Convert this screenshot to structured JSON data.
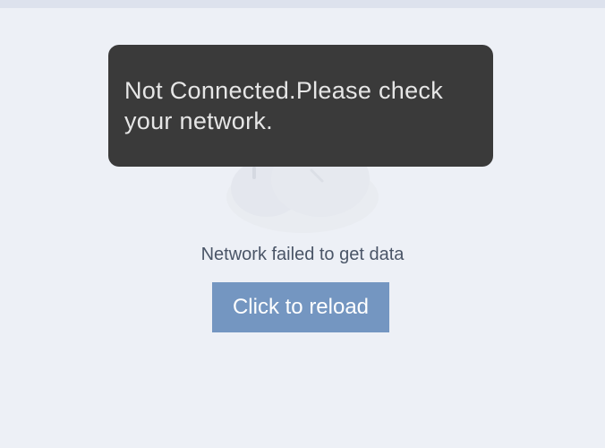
{
  "toast": {
    "message": "Not Connected.Please check your network."
  },
  "empty_state": {
    "illustration_icon": "cloud-disconnected-icon",
    "message": "Network failed to get data",
    "reload_label": "Click to reload"
  },
  "colors": {
    "background": "#edf0f6",
    "toast_background": "#3a3a3a",
    "button_background": "#7496c1",
    "message_text": "#4a5567"
  }
}
